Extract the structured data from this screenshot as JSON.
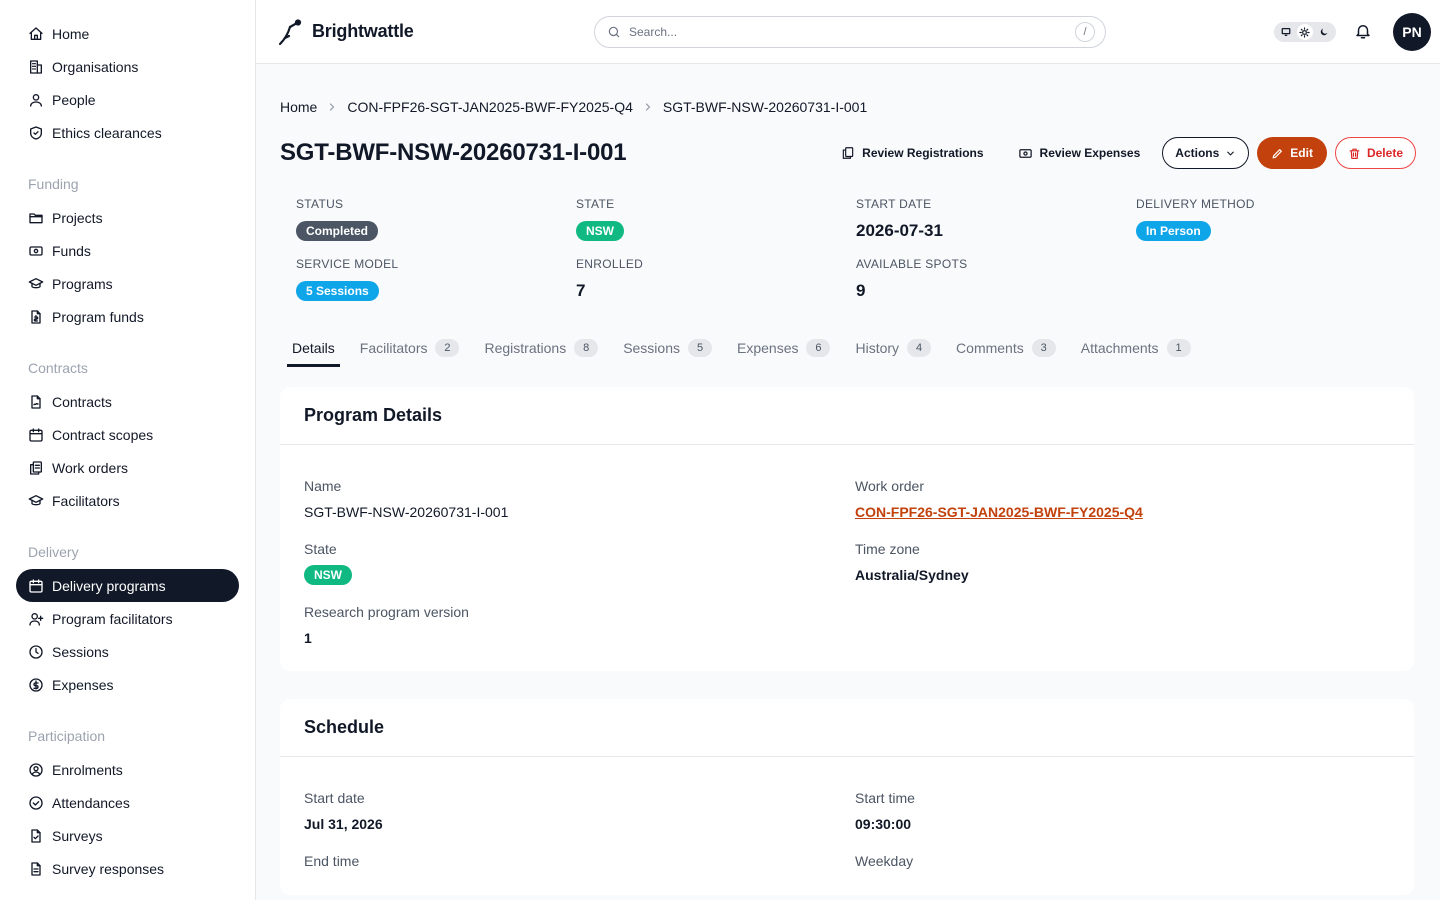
{
  "sidebar": {
    "top_items": [
      {
        "label": "Home",
        "icon": "home-icon"
      },
      {
        "label": "Organisations",
        "icon": "building-icon"
      },
      {
        "label": "People",
        "icon": "user-icon"
      },
      {
        "label": "Ethics clearances",
        "icon": "shield-check-icon"
      }
    ],
    "groups": [
      {
        "title": "Funding",
        "items": [
          {
            "label": "Projects",
            "icon": "folder-icon"
          },
          {
            "label": "Funds",
            "icon": "banknote-icon"
          },
          {
            "label": "Programs",
            "icon": "graduation-cap-icon"
          },
          {
            "label": "Program funds",
            "icon": "file-dollar-icon"
          }
        ]
      },
      {
        "title": "Contracts",
        "items": [
          {
            "label": "Contracts",
            "icon": "file-signature-icon"
          },
          {
            "label": "Contract scopes",
            "icon": "calendar-icon"
          },
          {
            "label": "Work orders",
            "icon": "clipboard-copy-icon"
          },
          {
            "label": "Facilitators",
            "icon": "graduation-cap-icon"
          }
        ]
      },
      {
        "title": "Delivery",
        "items": [
          {
            "label": "Delivery programs",
            "icon": "calendar-icon",
            "active": true
          },
          {
            "label": "Program facilitators",
            "icon": "user-plus-icon"
          },
          {
            "label": "Sessions",
            "icon": "clock-icon"
          },
          {
            "label": "Expenses",
            "icon": "dollar-circle-icon"
          }
        ]
      },
      {
        "title": "Participation",
        "items": [
          {
            "label": "Enrolments",
            "icon": "user-circle-icon"
          },
          {
            "label": "Attendances",
            "icon": "check-circle-icon"
          },
          {
            "label": "Surveys",
            "icon": "file-check-icon"
          },
          {
            "label": "Survey responses",
            "icon": "file-text-icon"
          }
        ]
      }
    ]
  },
  "topbar": {
    "brand": "Brightwattle",
    "search_placeholder": "Search...",
    "search_shortcut": "/",
    "avatar_initials": "PN"
  },
  "breadcrumb": [
    "Home",
    "CON-FPF26-SGT-JAN2025-BWF-FY2025-Q4",
    "SGT-BWF-NSW-20260731-I-001"
  ],
  "page": {
    "title": "SGT-BWF-NSW-20260731-I-001",
    "actions": {
      "review_registrations": "Review Registrations",
      "review_expenses": "Review Expenses",
      "actions": "Actions",
      "edit": "Edit",
      "delete": "Delete"
    }
  },
  "stats": {
    "status": {
      "label": "STATUS",
      "value": "Completed",
      "color": "#4b5563"
    },
    "state": {
      "label": "STATE",
      "value": "NSW",
      "color": "#10b981"
    },
    "start_date": {
      "label": "START DATE",
      "value": "2026-07-31"
    },
    "delivery_method": {
      "label": "DELIVERY METHOD",
      "value": "In Person",
      "color": "#0ea5e9"
    },
    "service_model": {
      "label": "SERVICE MODEL",
      "value": "5 Sessions",
      "color": "#0ea5e9"
    },
    "enrolled": {
      "label": "ENROLLED",
      "value": "7"
    },
    "available_spots": {
      "label": "AVAILABLE SPOTS",
      "value": "9"
    }
  },
  "tabs": [
    {
      "label": "Details",
      "count": null,
      "active": true
    },
    {
      "label": "Facilitators",
      "count": "2"
    },
    {
      "label": "Registrations",
      "count": "8"
    },
    {
      "label": "Sessions",
      "count": "5"
    },
    {
      "label": "Expenses",
      "count": "6"
    },
    {
      "label": "History",
      "count": "4"
    },
    {
      "label": "Comments",
      "count": "3"
    },
    {
      "label": "Attachments",
      "count": "1"
    }
  ],
  "program_details": {
    "title": "Program Details",
    "name_label": "Name",
    "name_value": "SGT-BWF-NSW-20260731-I-001",
    "work_order_label": "Work order",
    "work_order_value": "CON-FPF26-SGT-JAN2025-BWF-FY2025-Q4",
    "state_label": "State",
    "state_value": "NSW",
    "time_zone_label": "Time zone",
    "time_zone_value": "Australia/Sydney",
    "research_label": "Research program version",
    "research_value": "1"
  },
  "schedule": {
    "title": "Schedule",
    "start_date_label": "Start date",
    "start_date_value": "Jul 31, 2026",
    "start_time_label": "Start time",
    "start_time_value": "09:30:00",
    "end_time_label": "End time",
    "weekday_label": "Weekday"
  },
  "colors": {
    "accent": "#c2410c",
    "danger": "#dc2626",
    "dark": "#111827"
  }
}
